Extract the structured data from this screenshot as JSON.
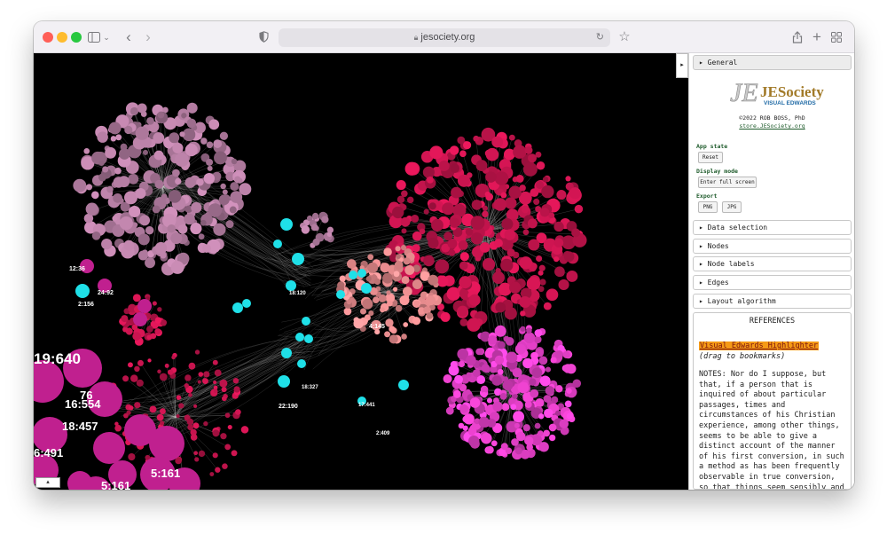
{
  "browser": {
    "url": "jesociety.org"
  },
  "panel": {
    "general_label": "General",
    "logo_text": "JESociety",
    "logo_subtitle": "VISUAL EDWARDS",
    "credit_line": "©2022 ROB BOSS, PhD",
    "store_link": "store.JESociety.org",
    "app_state_label": "App state",
    "reset_button": "Reset",
    "display_mode_label": "Display mode",
    "fullscreen_button": "Enter full screen",
    "export_label": "Export",
    "png_button": "PNG",
    "jpg_button": "JPG",
    "sections": [
      "Data selection",
      "Nodes",
      "Node labels",
      "Edges",
      "Layout algorithm"
    ],
    "references_title": "REFERENCES",
    "highlighter_link": "Visual Edwards Highlighter",
    "drag_note": "(drag to bookmarks)",
    "notes_text": "NOTES: Nor do I suppose, but that, if a person that is inquired of about particular passages, times and circumstances of his Christian experience, among other things, seems to be able to give a distinct account of the manner of his first conversion, in such a method as has been frequently observable in true conversion, so that things seem sensibly and distinctly to follow one another, in the order of time, according to the order of nature; it is an illustrating circumstance, that"
  },
  "viz": {
    "collapse_glyph": "▸",
    "corner_glyph": "▴",
    "colors": {
      "background": "#000000",
      "mauve": "#b07a9e",
      "crimson": "#c7144e",
      "magenta": "#e23fc6",
      "cyan": "#1fe0e8",
      "salmon": "#e48a8c"
    },
    "labels": [
      {
        "text": "19:640"
      },
      {
        "text": "16:554"
      },
      {
        "text": "18:457"
      },
      {
        "text": "5:161"
      },
      {
        "text": "6:491"
      },
      {
        "text": "76"
      },
      {
        "text": "24:92"
      },
      {
        "text": "2:156"
      },
      {
        "text": "12:36"
      },
      {
        "text": "4:145"
      },
      {
        "text": "22:190"
      },
      {
        "text": "17:441"
      },
      {
        "text": "2:409"
      },
      {
        "text": "18:327"
      },
      {
        "text": "18:120"
      }
    ]
  }
}
